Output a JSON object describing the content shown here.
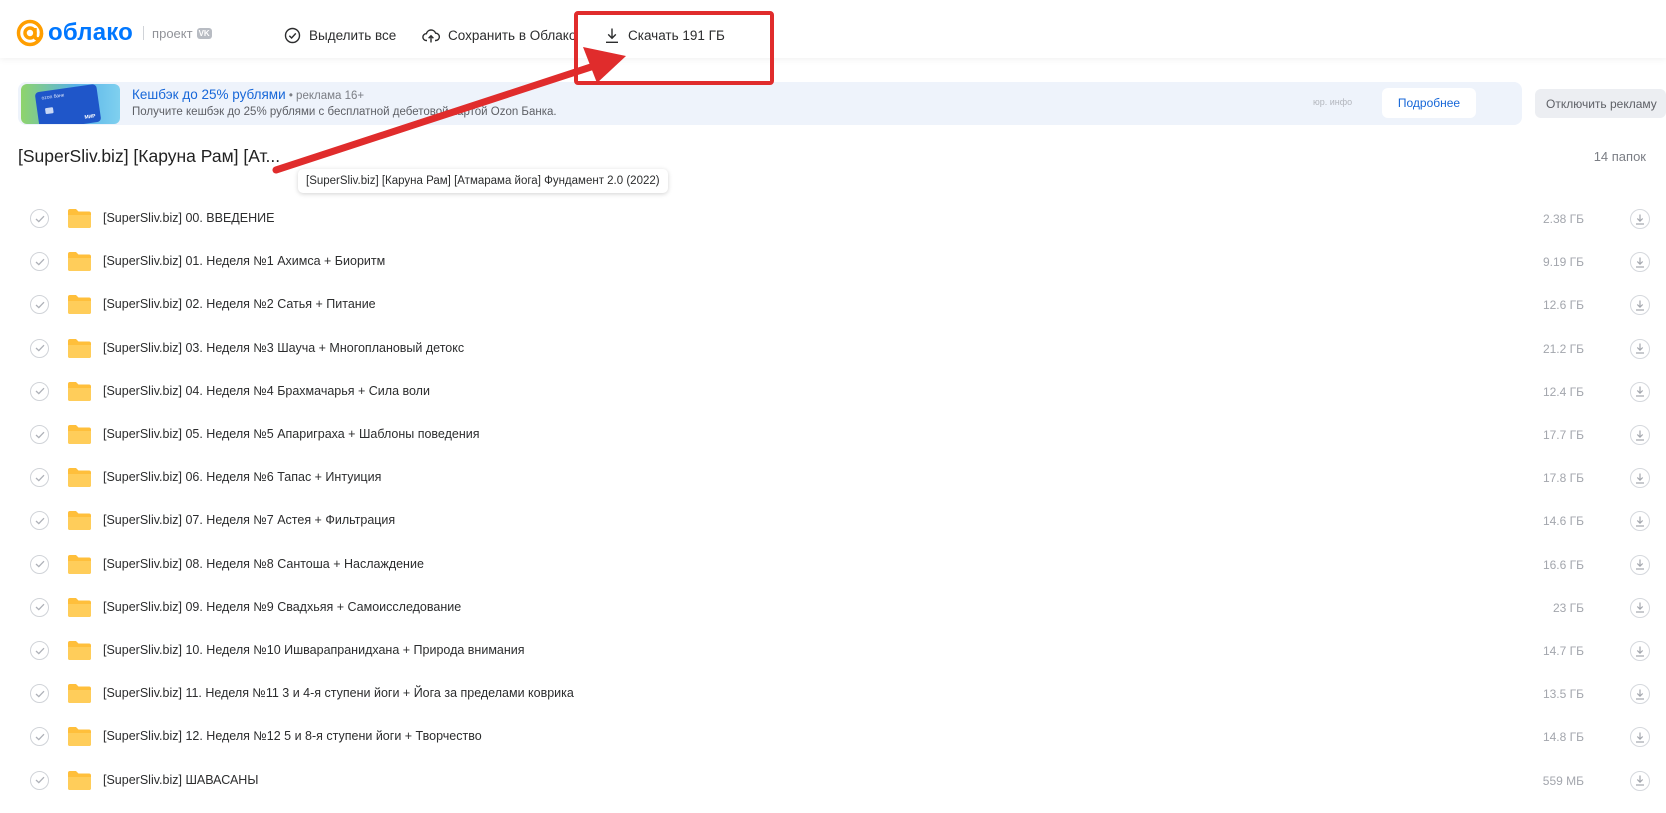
{
  "header": {
    "logo_text": "облако",
    "project_label": "проект",
    "vk_badge": "VK",
    "select_all": "Выделить все",
    "save_to_cloud": "Сохранить в Облако",
    "download": "Скачать 191 ГБ"
  },
  "ad": {
    "title": "Кешбэк до 25% рублями",
    "meta": " • реклама 16+",
    "description": "Получите кешбэк до 25% рублями с бесплатной дебетовой картой Ozon Банка.",
    "legal": "юр. инфо",
    "more_button": "Подробнее",
    "disable_button": "Отключить рекламу",
    "card_brand": "ozon банк",
    "card_mir": "МИР"
  },
  "folder": {
    "title_truncated": "[SuperSliv.biz] [Каруна Рам] [Ат...",
    "tooltip": "[SuperSliv.biz] [Каруна Рам] [Атмарама йога] Фундамент 2.0 (2022)",
    "count": "14 папок"
  },
  "items": [
    {
      "name": "[SuperSliv.biz] 00. ВВЕДЕНИЕ",
      "size": "2.38 ГБ"
    },
    {
      "name": "[SuperSliv.biz] 01. Неделя №1 Ахимса + Биоритм",
      "size": "9.19 ГБ"
    },
    {
      "name": "[SuperSliv.biz] 02. Неделя №2 Сатья + Питание",
      "size": "12.6 ГБ"
    },
    {
      "name": "[SuperSliv.biz] 03. Неделя №3 Шауча + Многоплановый детокс",
      "size": "21.2 ГБ"
    },
    {
      "name": "[SuperSliv.biz] 04. Неделя №4 Брахмачарья + Сила воли",
      "size": "12.4 ГБ"
    },
    {
      "name": "[SuperSliv.biz] 05. Неделя №5 Апариграха + Шаблоны поведения",
      "size": "17.7 ГБ"
    },
    {
      "name": "[SuperSliv.biz] 06. Неделя №6 Тапас + Интуиция",
      "size": "17.8 ГБ"
    },
    {
      "name": "[SuperSliv.biz] 07. Неделя №7 Астея + Фильтрация",
      "size": "14.6 ГБ"
    },
    {
      "name": "[SuperSliv.biz] 08. Неделя №8 Сантоша + Наслаждение",
      "size": "16.6 ГБ"
    },
    {
      "name": "[SuperSliv.biz] 09. Неделя №9 Свадхьяя + Самоисследование",
      "size": "23 ГБ"
    },
    {
      "name": "[SuperSliv.biz] 10. Неделя №10 Ишварапранидхана + Природа внимания",
      "size": "14.7 ГБ"
    },
    {
      "name": "[SuperSliv.biz] 11. Неделя №11 3 и 4-я ступени йоги + Йога за пределами коврика",
      "size": "13.5 ГБ"
    },
    {
      "name": "[SuperSliv.biz] 12. Неделя №12 5 и 8-я ступени йоги + Творчество",
      "size": "14.8 ГБ"
    },
    {
      "name": "[SuperSliv.biz] ШАВАСАНЫ",
      "size": "559 МБ"
    }
  ],
  "colors": {
    "brand_orange": "#ff9e00",
    "brand_blue": "#0077ff",
    "folder_yellow": "#ffc84d",
    "annotation_red": "#e02c2c"
  }
}
